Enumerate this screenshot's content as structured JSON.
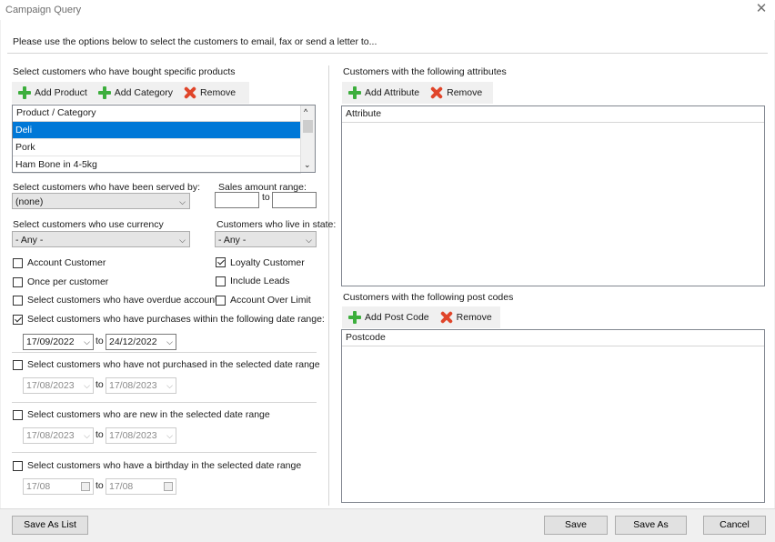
{
  "window": {
    "title": "Campaign Query"
  },
  "intro": "Please use the options below to select the customers to email, fax or send a letter to...",
  "products": {
    "heading": "Select customers who have bought specific products",
    "add_product": "Add Product",
    "add_category": "Add Category",
    "remove": "Remove",
    "column": "Product / Category",
    "rows": [
      "Deli",
      "Pork",
      "Ham Bone in 4-5kg"
    ]
  },
  "served_by": {
    "label": "Select customers who have been served by:",
    "value": "(none)"
  },
  "sales_range": {
    "label": "Sales amount range:",
    "to": "to",
    "from_value": "",
    "to_value": ""
  },
  "currency": {
    "label": "Select customers who use currency",
    "value": "- Any -"
  },
  "state": {
    "label": "Customers who live in state:",
    "value": "- Any -"
  },
  "checks": {
    "account_customer": "Account Customer",
    "loyalty_customer": "Loyalty Customer",
    "once_per_customer": "Once per customer",
    "include_leads": "Include Leads",
    "overdue_accounts": "Select customers who have overdue accounts",
    "account_over_limit": "Account Over Limit"
  },
  "ranges": {
    "purchased": {
      "label": "Select customers who have purchases within the following date range:",
      "from": "17/09/2022",
      "to_label": "to",
      "to": "24/12/2022"
    },
    "not_purchased": {
      "label": "Select customers who have not purchased in the selected date range",
      "from": "17/08/2023",
      "to_label": "to",
      "to": "17/08/2023"
    },
    "new_customers": {
      "label": "Select customers who are new in the selected date range",
      "from": "17/08/2023",
      "to_label": "to",
      "to": "17/08/2023"
    },
    "birthday": {
      "label": "Select customers who have a birthday in the selected date range",
      "from": "17/08",
      "to_label": "to",
      "to": "17/08"
    }
  },
  "attributes": {
    "heading": "Customers with the following attributes",
    "add": "Add Attribute",
    "remove": "Remove",
    "column": "Attribute"
  },
  "postcodes": {
    "heading": "Customers with the following post codes",
    "add": "Add Post Code",
    "remove": "Remove",
    "column": "Postcode"
  },
  "footer": {
    "save_as_list": "Save As List",
    "save": "Save",
    "save_as": "Save As",
    "cancel": "Cancel"
  },
  "colors": {
    "selection": "#0078d7",
    "add_icon": "#3cae3c",
    "remove_icon": "#e0452a"
  }
}
